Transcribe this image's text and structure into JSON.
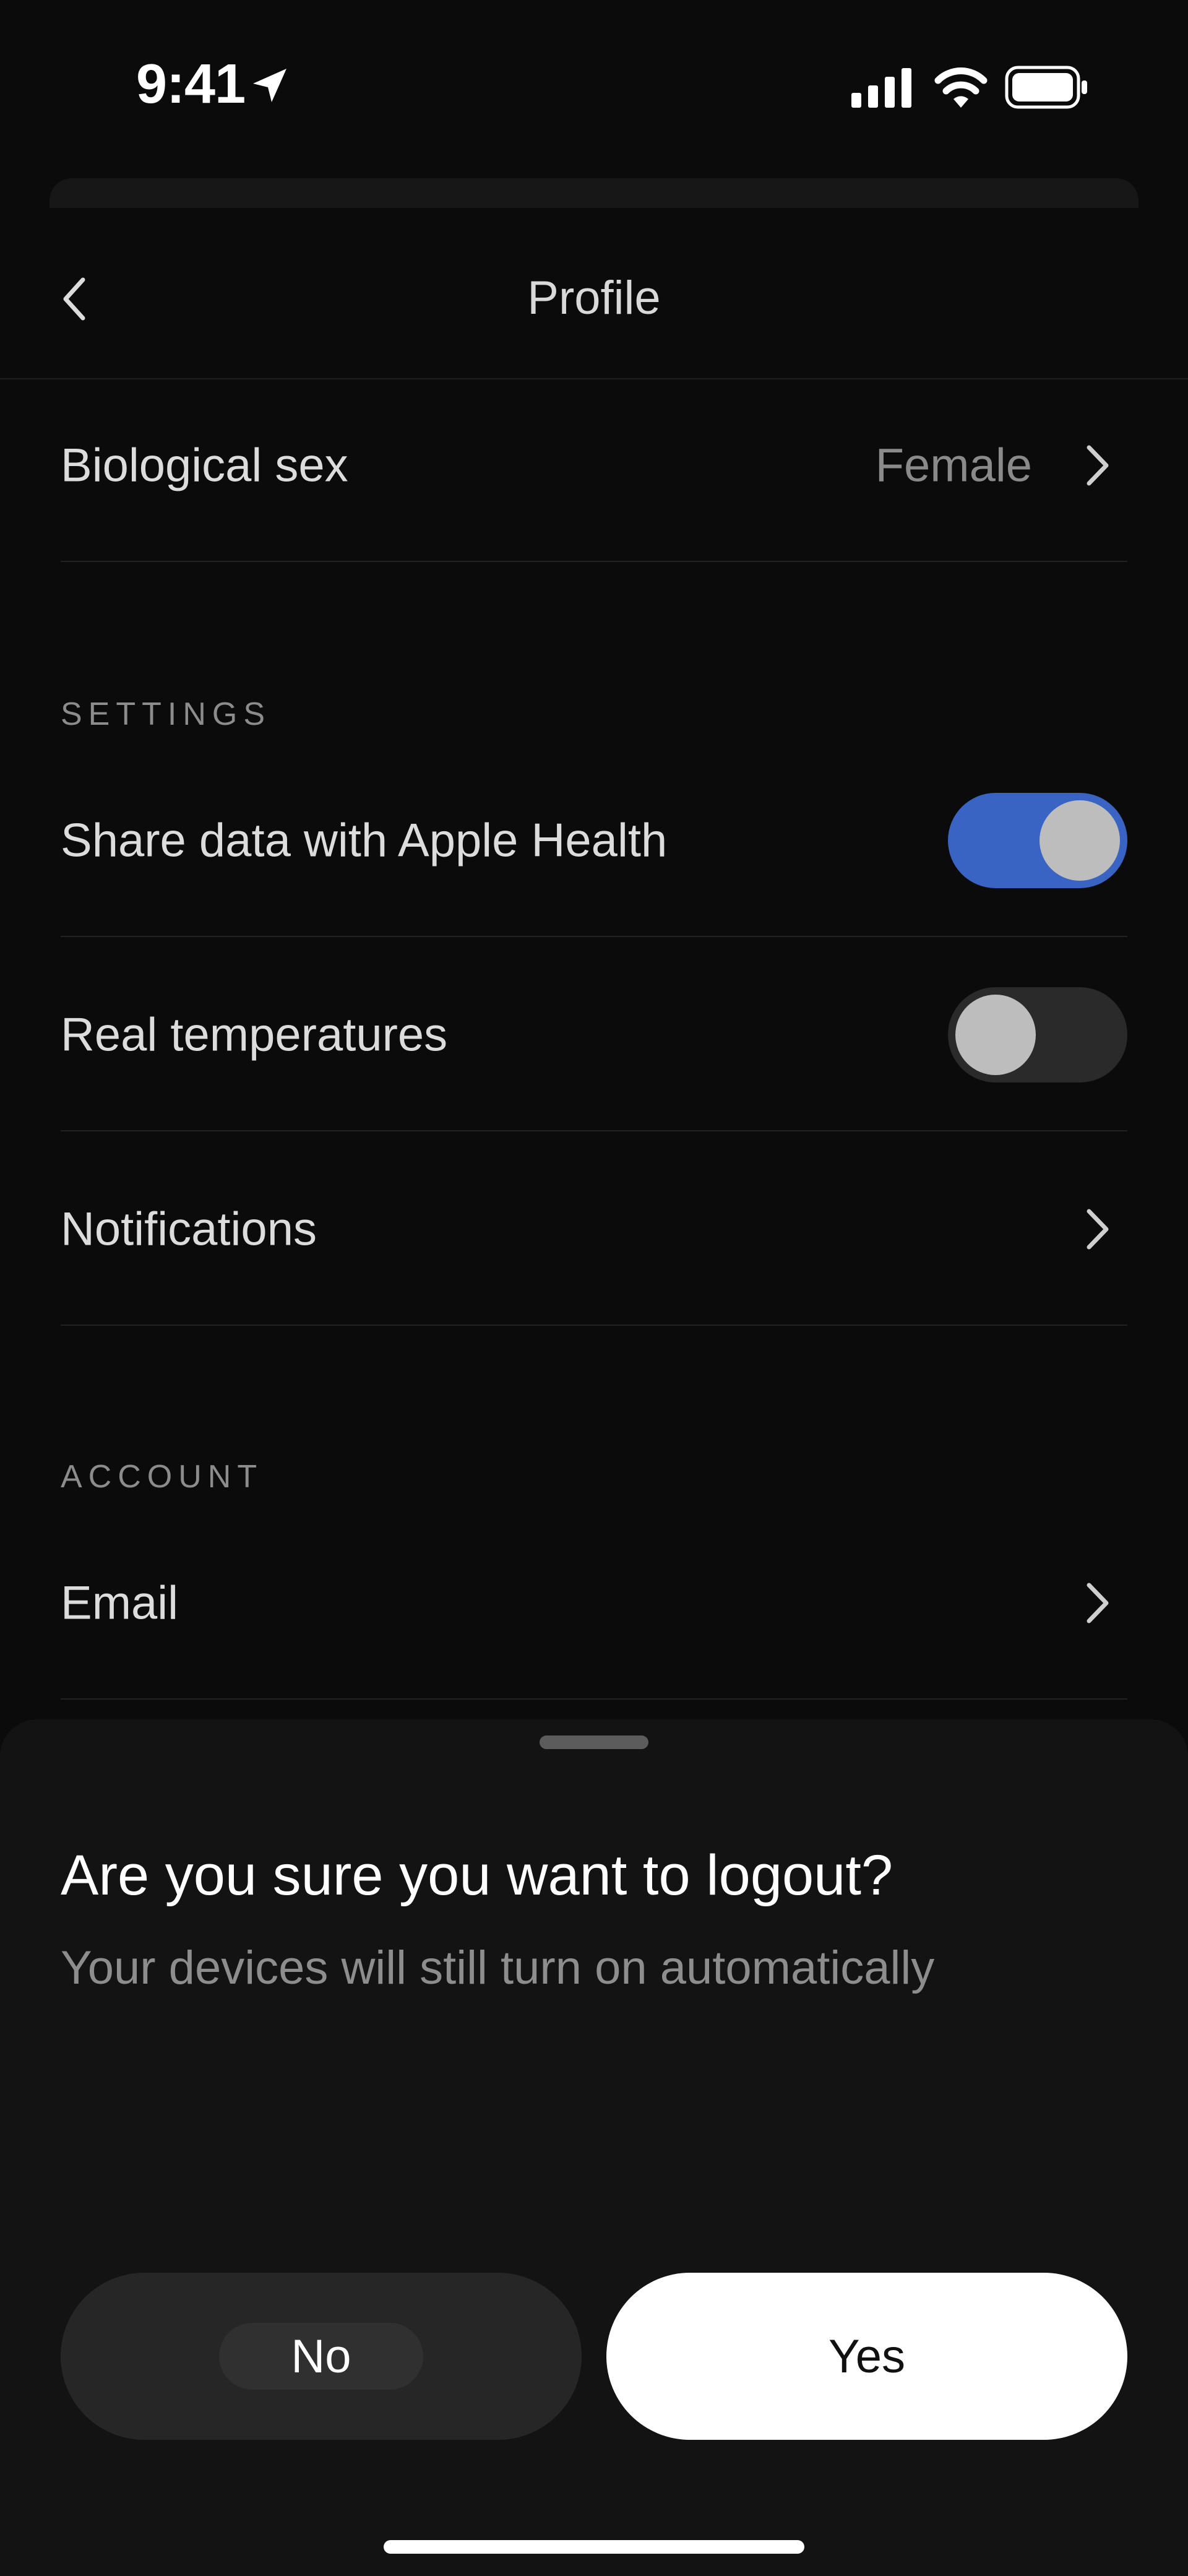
{
  "status_bar": {
    "time": "9:41",
    "icons": [
      "location-arrow-icon",
      "cellular-signal-icon",
      "wifi-icon",
      "battery-icon"
    ]
  },
  "nav": {
    "title": "Profile",
    "back_icon": "chevron-left-icon"
  },
  "profile_rows": [
    {
      "label": "Biological sex",
      "value": "Female",
      "icon": "chevron-right-icon"
    }
  ],
  "settings": {
    "section_title": "SETTINGS",
    "items": [
      {
        "label": "Share data with Apple Health",
        "control": "toggle",
        "state": "on"
      },
      {
        "label": "Real temperatures",
        "control": "toggle",
        "state": "off"
      },
      {
        "label": "Notifications",
        "control": "chevron",
        "icon": "chevron-right-icon"
      }
    ]
  },
  "account": {
    "section_title": "ACCOUNT",
    "items": [
      {
        "label": "Email",
        "control": "chevron",
        "icon": "chevron-right-icon"
      }
    ]
  },
  "logout_modal": {
    "title": "Are you sure you want to logout?",
    "subtitle": "Your devices will still turn on automatically",
    "no_label": "No",
    "yes_label": "Yes"
  },
  "colors": {
    "background": "#0b0b0b",
    "modal_background": "#131313",
    "toggle_on": "#3a64c4",
    "toggle_off": "#2a2a2a",
    "yes_button": "#ffffff",
    "no_button": "#262626"
  }
}
